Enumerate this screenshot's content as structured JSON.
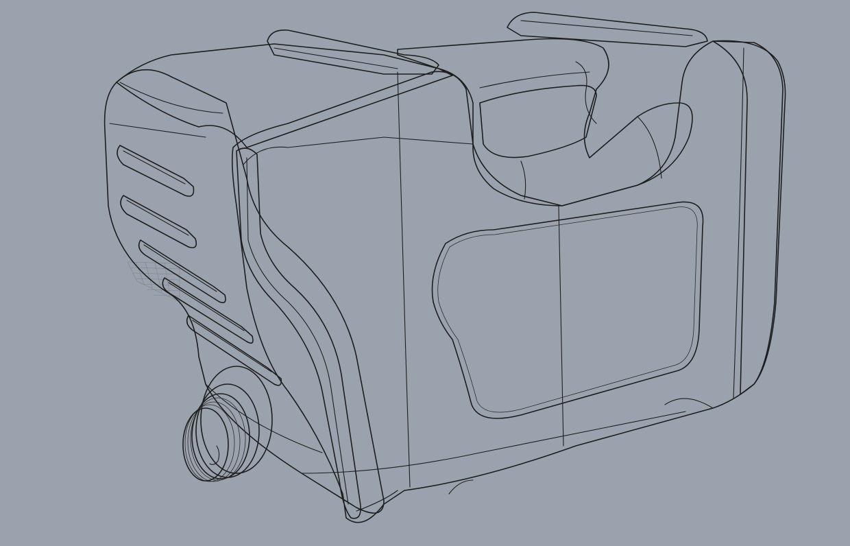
{
  "viewport": {
    "display_mode": "shaded",
    "background_color": "#9aa3ad",
    "model": {
      "object": "jerrycan",
      "surface_color": "#c9c9c9",
      "edge_color": "#1d1d1d"
    }
  }
}
